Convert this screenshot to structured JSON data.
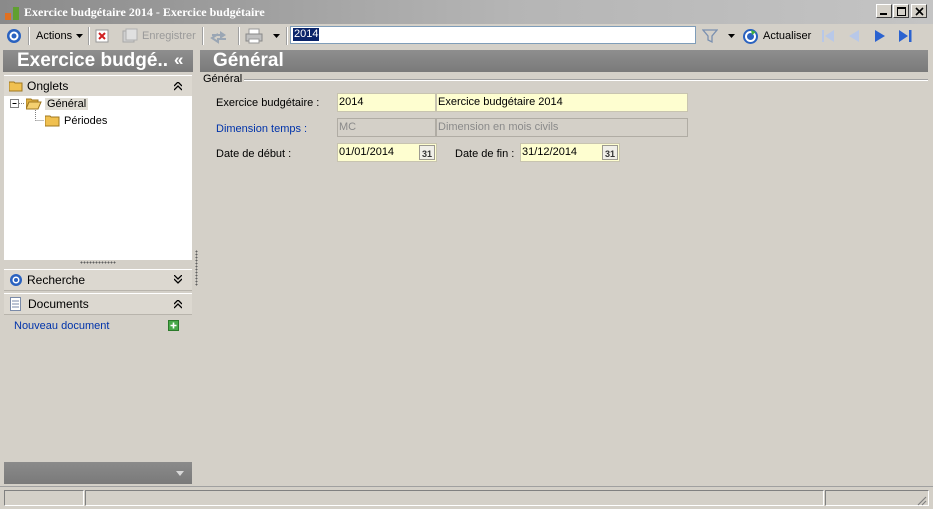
{
  "window": {
    "title": "Exercice budgétaire 2014 -  Exercice budgétaire",
    "minimize_glyph": "_",
    "maximize_glyph": "□",
    "close_glyph": "✕"
  },
  "toolbar": {
    "actions_label": "Actions",
    "save_label": "Enregistrer",
    "search_value": "2014",
    "refresh_label": "Actualiser"
  },
  "left_panel": {
    "title": "Exercice budgé..",
    "collapse_glyph": "«",
    "tabs_section": {
      "label": "Onglets",
      "toggle": "»"
    },
    "tree": [
      {
        "label": "Général",
        "expander": "−",
        "selected": true
      },
      {
        "label": "Périodes"
      }
    ],
    "search_section": {
      "label": "Recherche"
    },
    "documents_section": {
      "label": "Documents",
      "new_document": "Nouveau document"
    }
  },
  "right_panel": {
    "title": "Général",
    "group_label": "Général",
    "fields": {
      "exercice": {
        "label": "Exercice budgétaire :",
        "code": "2014",
        "description": "Exercice budgétaire 2014"
      },
      "dimension": {
        "label": "Dimension temps :",
        "code": "MC",
        "description": "Dimension en mois civils"
      },
      "start_date": {
        "label": "Date de début :",
        "value": "01/01/2014"
      },
      "end_date": {
        "label": "Date de fin :",
        "value": "31/12/2014"
      }
    },
    "calendar_icon_text": "31"
  },
  "colors": {
    "field_bg": "#fefed0",
    "header_bg": "#7f7f7f",
    "link": "#0033aa",
    "toolbar_bg": "#d4d0c8"
  }
}
